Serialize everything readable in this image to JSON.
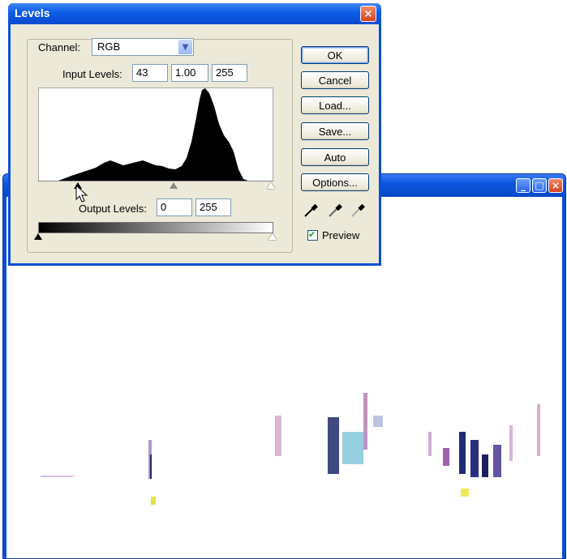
{
  "dialog": {
    "title": "Levels",
    "channel_label": "Channel:",
    "channel_value": "RGB",
    "input_levels_label": "Input Levels:",
    "input_black": "43",
    "input_gamma": "1.00",
    "input_white": "255",
    "output_levels_label": "Output Levels:",
    "output_black": "0",
    "output_white": "255",
    "buttons": {
      "ok": "OK",
      "cancel": "Cancel",
      "load": "Load...",
      "save": "Save...",
      "auto": "Auto",
      "options": "Options..."
    },
    "preview_label": "Preview",
    "preview_checked": true
  },
  "icons": {
    "close": "close-icon",
    "minimize": "minimize-icon",
    "maximize": "maximize-icon",
    "dropdown": "chevron-down-icon",
    "eyedropper": "eyedropper-icon",
    "cursor": "arrow-cursor-icon"
  },
  "colors": {
    "titlebar_blue": "#0b5be6",
    "dialog_face": "#ece9d8",
    "close_red": "#d8431e"
  }
}
